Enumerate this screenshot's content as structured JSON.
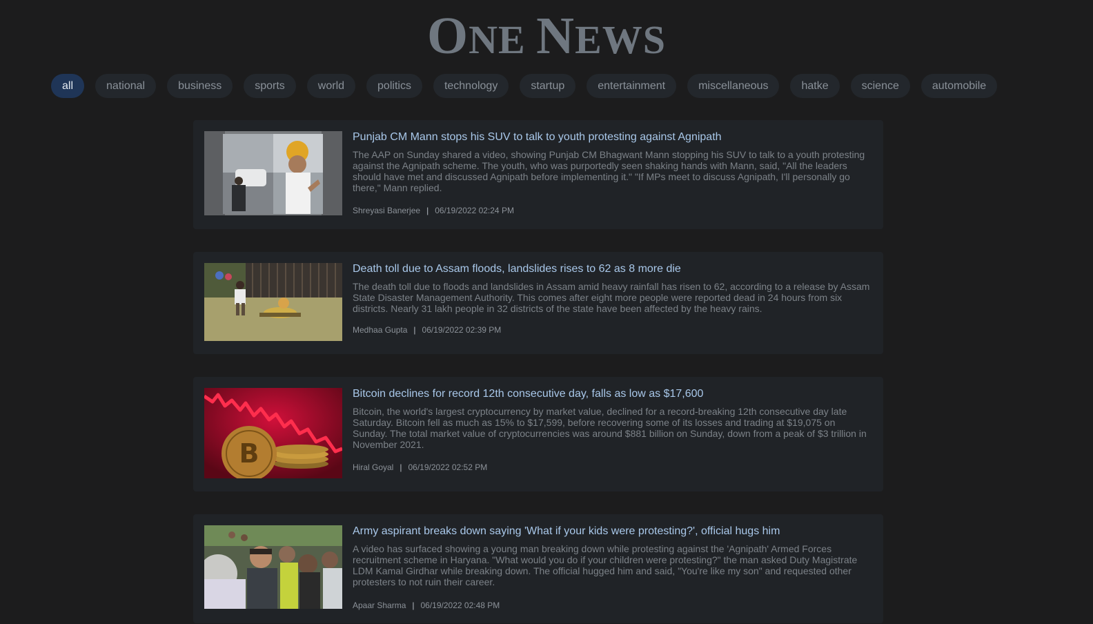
{
  "brand": {
    "first_big": "O",
    "first_rest": "NE ",
    "second_big": "N",
    "second_rest": "EWS"
  },
  "categories": [
    {
      "label": "all",
      "active": true
    },
    {
      "label": "national"
    },
    {
      "label": "business"
    },
    {
      "label": "sports"
    },
    {
      "label": "world"
    },
    {
      "label": "politics"
    },
    {
      "label": "technology"
    },
    {
      "label": "startup"
    },
    {
      "label": "entertainment"
    },
    {
      "label": "miscellaneous"
    },
    {
      "label": "hatke"
    },
    {
      "label": "science"
    },
    {
      "label": "automobile"
    }
  ],
  "articles": [
    {
      "title": "Punjab CM Mann stops his SUV to talk to youth protesting against Agnipath",
      "description": "The AAP on Sunday shared a video, showing Punjab CM Bhagwant Mann stopping his SUV to talk to a youth protesting against the Agnipath scheme. The youth, who was purportedly seen shaking hands with Mann, said, \"All the leaders should have met and discussed Agnipath before implementing it.\" \"If MPs meet to discuss Agnipath, I'll personally go there,\" Mann replied.",
      "author": "Shreyasi Banerjee",
      "separator": "|",
      "date": "06/19/2022 02:24 PM"
    },
    {
      "title": "Death toll due to Assam floods, landslides rises to 62 as 8 more die",
      "description": "The death toll due to floods and landslides in Assam amid heavy rainfall has risen to 62, according to a release by Assam State Disaster Management Authority. This comes after eight more people were reported dead in 24 hours from six districts. Nearly 31 lakh people in 32 districts of the state have been affected by the heavy rains.",
      "author": "Medhaa Gupta",
      "separator": "|",
      "date": "06/19/2022 02:39 PM"
    },
    {
      "title": "Bitcoin declines for record 12th consecutive day, falls as low as $17,600",
      "description": "Bitcoin, the world's largest cryptocurrency by market value, declined for a record-breaking 12th consecutive day late Saturday. Bitcoin fell as much as 15% to $17,599, before recovering some of its losses and trading at $19,075 on Sunday. The total market value of cryptocurrencies was around $881 billion on Sunday, down from a peak of $3 trillion in November 2021.",
      "author": "Hiral Goyal",
      "separator": "|",
      "date": "06/19/2022 02:52 PM"
    },
    {
      "title": "Army aspirant breaks down saying 'What if your kids were protesting?', official hugs him",
      "description": "A video has surfaced showing a young man breaking down while protesting against the 'Agnipath' Armed Forces recruitment scheme in Haryana. \"What would you do if your children were protesting?\" the man asked Duty Magistrate LDM Kamal Girdhar while breaking down. The official hugged him and said, \"You're like my son\" and requested other protesters to not ruin their career.",
      "author": "Apaar Sharma",
      "separator": "|",
      "date": "06/19/2022 02:48 PM"
    }
  ]
}
